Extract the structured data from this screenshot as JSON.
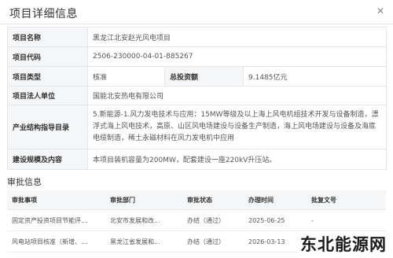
{
  "dialog": {
    "title": "项目详细信息",
    "close_glyph": "✕"
  },
  "info": {
    "project_name": {
      "label": "项目名称",
      "value": "黑龙江北安赵光风电项目"
    },
    "project_code": {
      "label": "项目代码",
      "value": "2506-230000-04-01-885267"
    },
    "project_type": {
      "label": "项目类型",
      "value": "核准"
    },
    "total_investment": {
      "label": "总投资额",
      "value": "9.1485亿元"
    },
    "legal_entity": {
      "label": "项目法人单位",
      "value": "国能北安热电有限公司"
    },
    "industry_guide": {
      "label": "产业结构指导目录",
      "value": "5.新能源-1.风力发电技术与应用：15MW等级及以上海上风电机组技术开发与设备制造，漂浮式海上风电技术，高原、山区风电场建设与设备生产制造，海上风电场建设与设备及海底电缆制造，稀土永磁材料在风力发电机中应用"
    },
    "scale_content": {
      "label": "建设规模及内容",
      "value": "本项目装机容量为200MW，配套建设一座220kV升压站。"
    }
  },
  "approval": {
    "section_title": "审批信息",
    "headers": [
      "审批事项",
      "审批部门",
      "审批状态",
      "办理时间",
      "批复文号"
    ],
    "rows": [
      [
        "固定资产投资项目节能评...",
        "北安市发展和改...",
        "办结（通过）",
        "2025-06-25",
        "-"
      ],
      [
        "风电站项目核准（新增、...",
        "黑龙江省发展和...",
        "办结（通过）",
        "2026-03-13",
        ""
      ]
    ]
  },
  "watermark": "东北能源网"
}
